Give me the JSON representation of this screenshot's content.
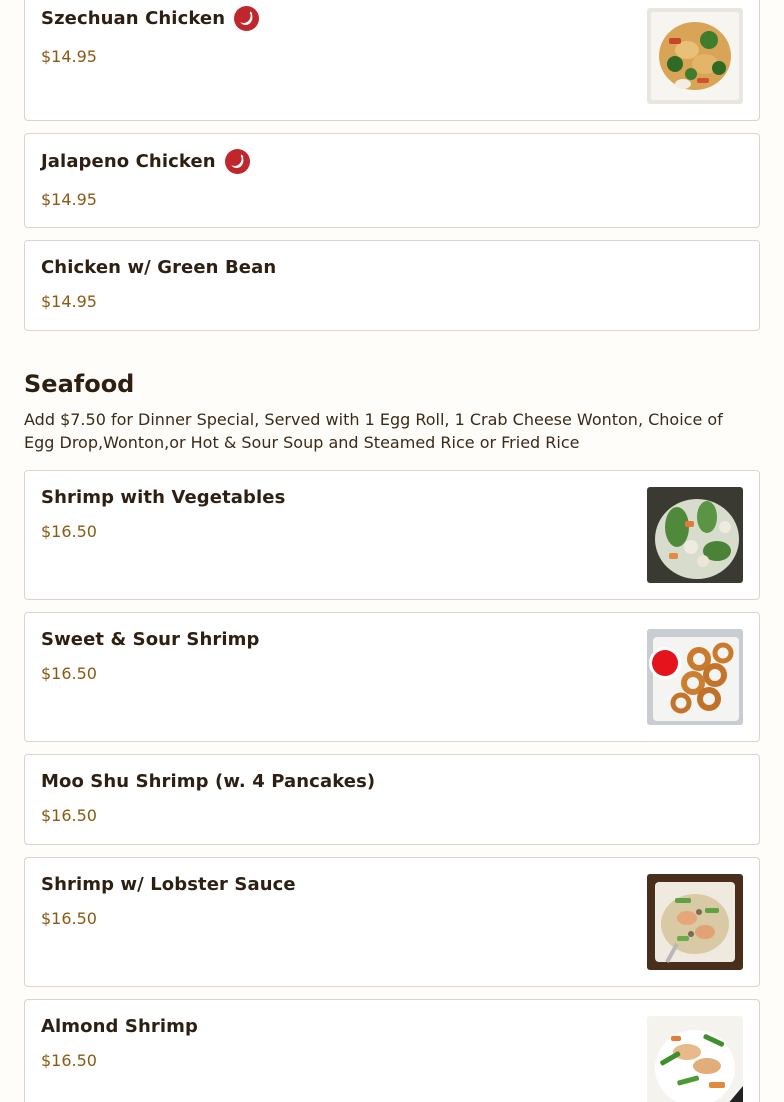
{
  "items_top": [
    {
      "name": "Szechuan Chicken",
      "price": "$14.95",
      "spicy": true,
      "icon": "chili-pepper-icon"
    },
    {
      "name": "Jalapeno Chicken",
      "price": "$14.95",
      "spicy": true,
      "icon": "chili-pepper-icon"
    },
    {
      "name": "Chicken w/ Green Bean",
      "price": "$14.95",
      "spicy": false
    }
  ],
  "seafood": {
    "title": "Seafood",
    "description": "Add $7.50 for Dinner Special, Served with 1 Egg Roll, 1 Crab Cheese Wonton, Choice of Egg Drop,Wonton,or Hot & Sour Soup and Steamed Rice or Fried Rice",
    "items": [
      {
        "name": "Shrimp with Vegetables",
        "price": "$16.50",
        "has_photo": true
      },
      {
        "name": "Sweet & Sour Shrimp",
        "price": "$16.50",
        "has_photo": true
      },
      {
        "name": "Moo Shu Shrimp (w. 4 Pancakes)",
        "price": "$16.50",
        "has_photo": false
      },
      {
        "name": "Shrimp w/ Lobster Sauce",
        "price": "$16.50",
        "has_photo": true
      },
      {
        "name": "Almond Shrimp",
        "price": "$16.50",
        "has_photo": true
      }
    ]
  },
  "colors": {
    "title": "#2d1f12",
    "price": "#8a5a12",
    "spicy_icon_bg": "#c0272d",
    "card_border": "#d9d4cd"
  }
}
